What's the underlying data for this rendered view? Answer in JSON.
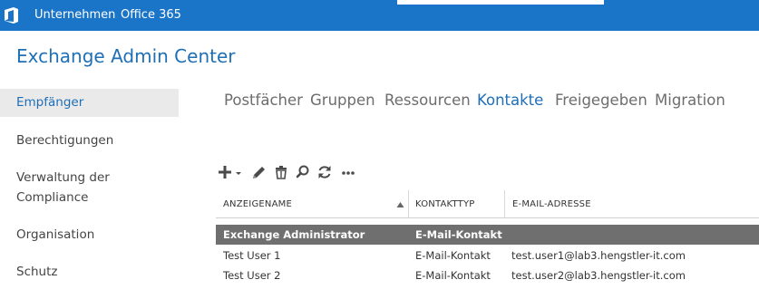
{
  "topbar": {
    "logo_icon": "office-icon",
    "items": [
      "Unternehmen",
      "Office 365"
    ],
    "bg_color": "#1a74c7"
  },
  "app": {
    "title": "Exchange Admin Center"
  },
  "sidebar": {
    "items": [
      {
        "label": "Empfänger",
        "active": true
      },
      {
        "label": "Berechtigungen"
      },
      {
        "label": "Verwaltung der Compliance"
      },
      {
        "label": "Organisation"
      },
      {
        "label": "Schutz"
      }
    ]
  },
  "tabs": [
    {
      "label": "Postfächer"
    },
    {
      "label": "Gruppen"
    },
    {
      "label": "Ressourcen"
    },
    {
      "label": "Kontakte",
      "active": true
    },
    {
      "label": "Freigegeben"
    },
    {
      "label": "Migration"
    }
  ],
  "toolbar": {
    "icons": [
      "add-icon",
      "edit-icon",
      "delete-icon",
      "search-icon",
      "refresh-icon",
      "more-icon"
    ]
  },
  "table": {
    "columns": [
      "ANZEIGENAME",
      "KONTAKTTYP",
      "E-MAIL-ADRESSE"
    ],
    "sort_icon": "sort-ascending-icon",
    "rows": [
      {
        "name": "Exchange Administrator",
        "type": "E-Mail-Kontakt",
        "email": "",
        "selected": true
      },
      {
        "name": "Test User 1",
        "type": "E-Mail-Kontakt",
        "email": "test.user1@lab3.hengstler-it.com"
      },
      {
        "name": "Test User 2",
        "type": "E-Mail-Kontakt",
        "email": "test.user2@lab3.hengstler-it.com"
      }
    ]
  },
  "colors": {
    "accent": "#1e6eb7",
    "selected_row": "#6f6f6f"
  }
}
